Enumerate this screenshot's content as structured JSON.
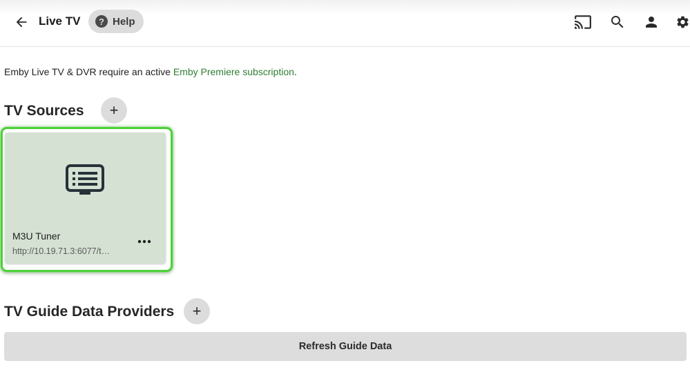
{
  "header": {
    "title": "Live TV",
    "help_label": "Help",
    "icons": [
      "back-arrow-icon",
      "cast-icon",
      "search-icon",
      "user-icon",
      "settings-icon"
    ]
  },
  "notice": {
    "prefix": "Emby Live TV & DVR require an active ",
    "link": "Emby Premiere subscription",
    "suffix": "."
  },
  "tv_sources": {
    "title": "TV Sources",
    "add_label": "+",
    "items": [
      {
        "name": "M3U Tuner",
        "url": "http://10.19.71.3:6077/t…",
        "icon": "tv-tuner-icon"
      }
    ]
  },
  "guide_providers": {
    "title": "TV Guide Data Providers",
    "add_label": "+"
  },
  "refresh_label": "Refresh Guide Data",
  "colors": {
    "accent_link": "#2e7d32",
    "selected_outline": "#4cd137",
    "card_bg": "#d5e1d3",
    "button_bg": "#dcdcdc"
  }
}
